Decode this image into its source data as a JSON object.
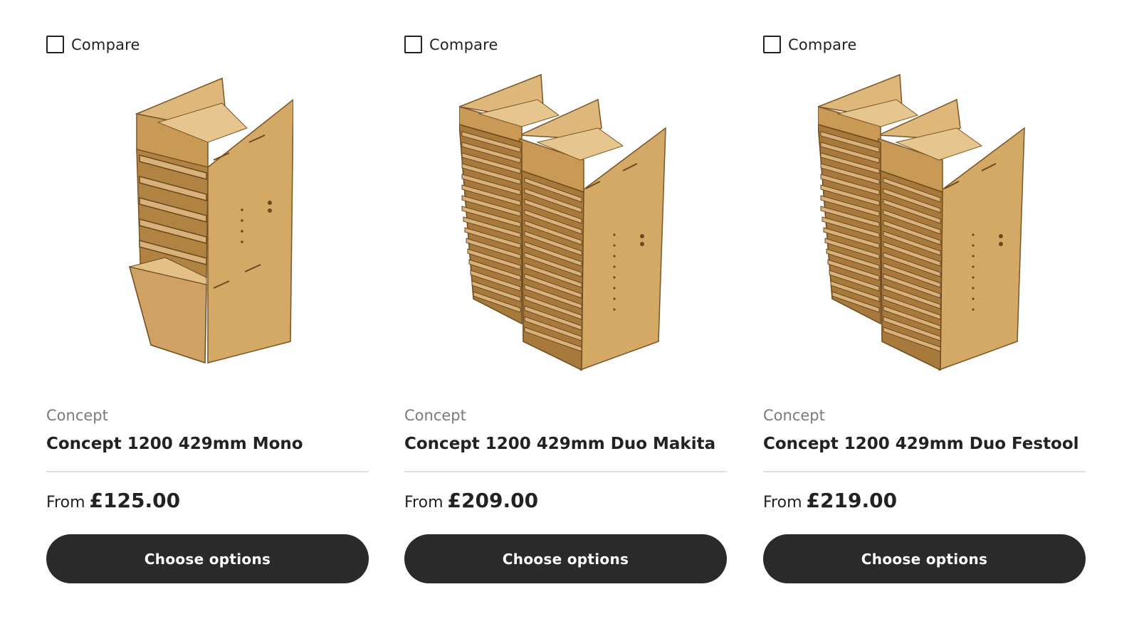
{
  "products": [
    {
      "compare_label": "Compare",
      "brand": "Concept",
      "title": "Concept 1200 429mm Mono",
      "price_prefix": "From",
      "price": "£125.00",
      "button_label": "Choose options"
    },
    {
      "compare_label": "Compare",
      "brand": "Concept",
      "title": "Concept 1200 429mm Duo Makita",
      "price_prefix": "From",
      "price": "£209.00",
      "button_label": "Choose options"
    },
    {
      "compare_label": "Compare",
      "brand": "Concept",
      "title": "Concept 1200 429mm Duo Festool",
      "price_prefix": "From",
      "price": "£219.00",
      "button_label": "Choose options"
    }
  ],
  "colors": {
    "button_bg": "#2a2a2a",
    "wood_light": "#d9b377",
    "wood_mid": "#c79a55",
    "wood_dark": "#9c7136"
  }
}
